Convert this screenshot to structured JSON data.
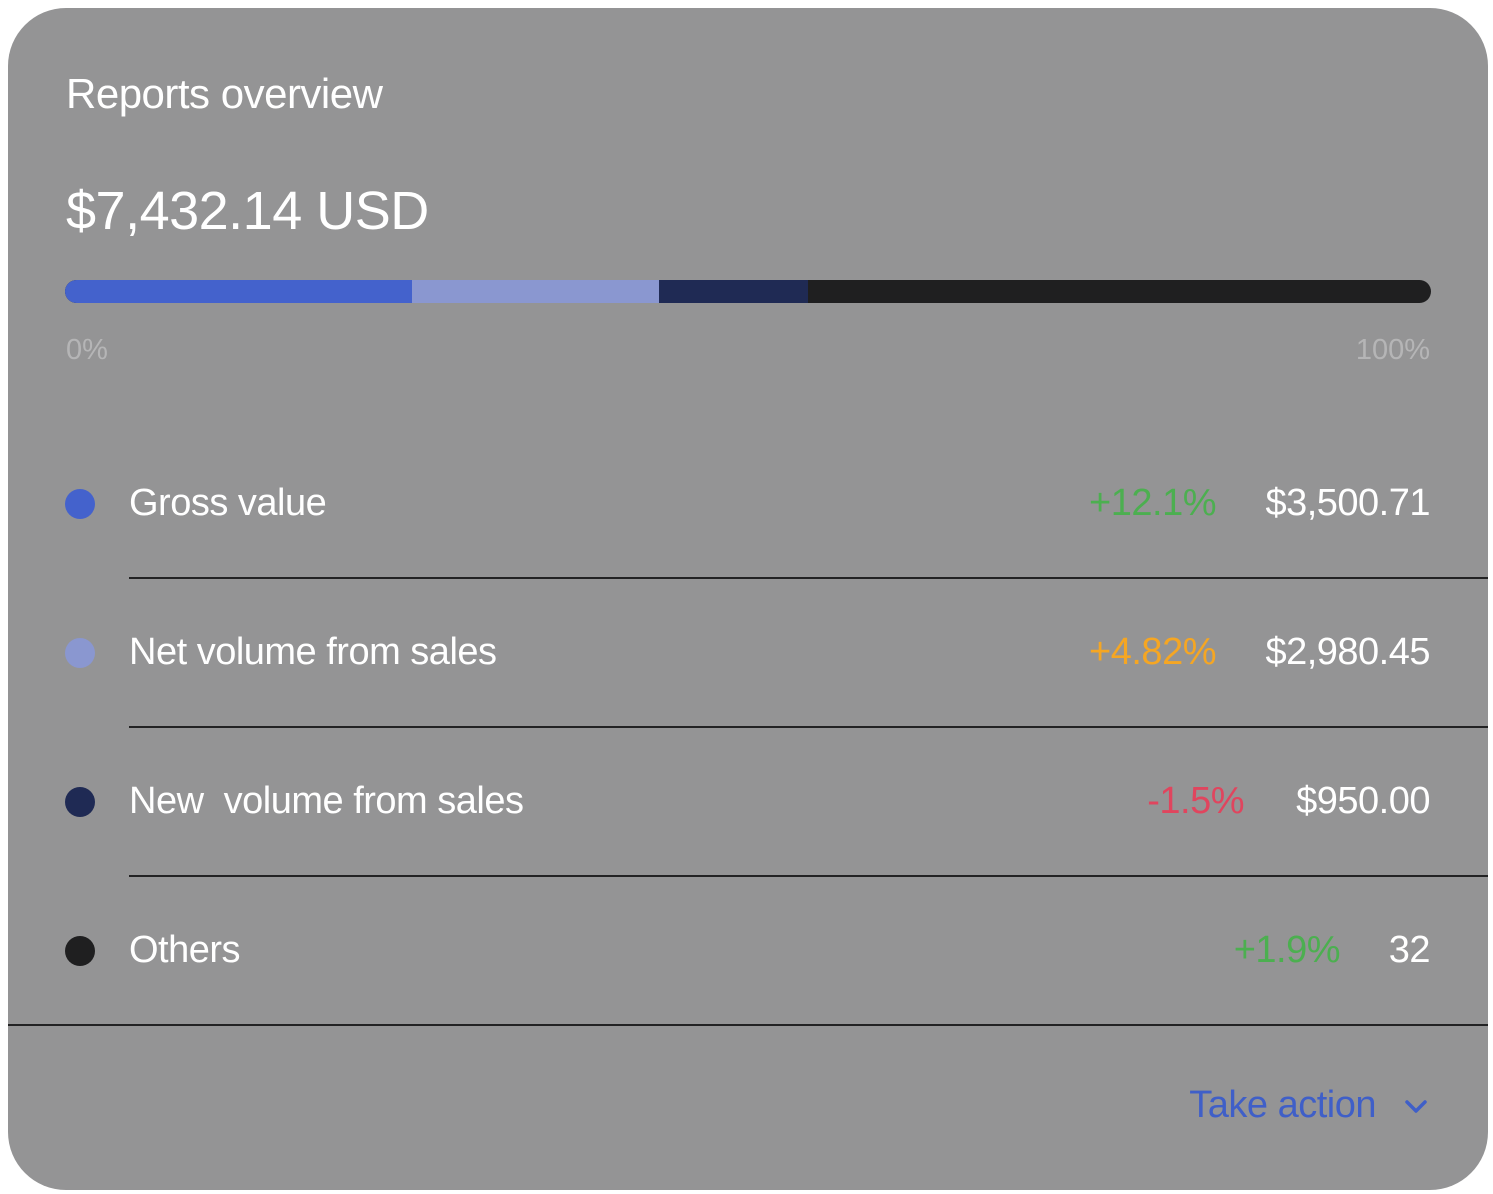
{
  "card": {
    "title": "Reports overview",
    "total": "$7,432.14 USD"
  },
  "progress": {
    "min_label": "0%",
    "max_label": "100%",
    "track_color": "#1f1f20",
    "segments": [
      {
        "name": "Gross value",
        "fraction": 0.254,
        "color": "#4462cc"
      },
      {
        "name": "Net volume from sales",
        "fraction": 0.181,
        "color": "#8a97d0"
      },
      {
        "name": "New  volume from sales",
        "fraction": 0.109,
        "color": "#1f2a54"
      }
    ]
  },
  "breakdown": [
    {
      "label": "Gross value",
      "change": "+12.1%",
      "change_color": "#4caf50",
      "value": "$3,500.71",
      "dot_color": "#4462cc",
      "dot_icon": "circle-icon"
    },
    {
      "label": "Net volume from sales",
      "change": "+4.82%",
      "change_color": "#f5a623",
      "value": "$2,980.45",
      "dot_color": "#8a97d0",
      "dot_icon": "circle-icon"
    },
    {
      "label": "New  volume from sales",
      "change": "-1.5%",
      "change_color": "#e0455e",
      "value": "$950.00",
      "dot_color": "#1f2a54",
      "dot_icon": "circle-icon"
    },
    {
      "label": "Others",
      "change": "+1.9%",
      "change_color": "#4caf50",
      "value": "32",
      "dot_color": "#1f1f20",
      "dot_icon": "circle-icon"
    }
  ],
  "footer": {
    "action_label": "Take action",
    "action_icon": "chevron-down-icon",
    "accent_color": "#3f5fc8"
  }
}
